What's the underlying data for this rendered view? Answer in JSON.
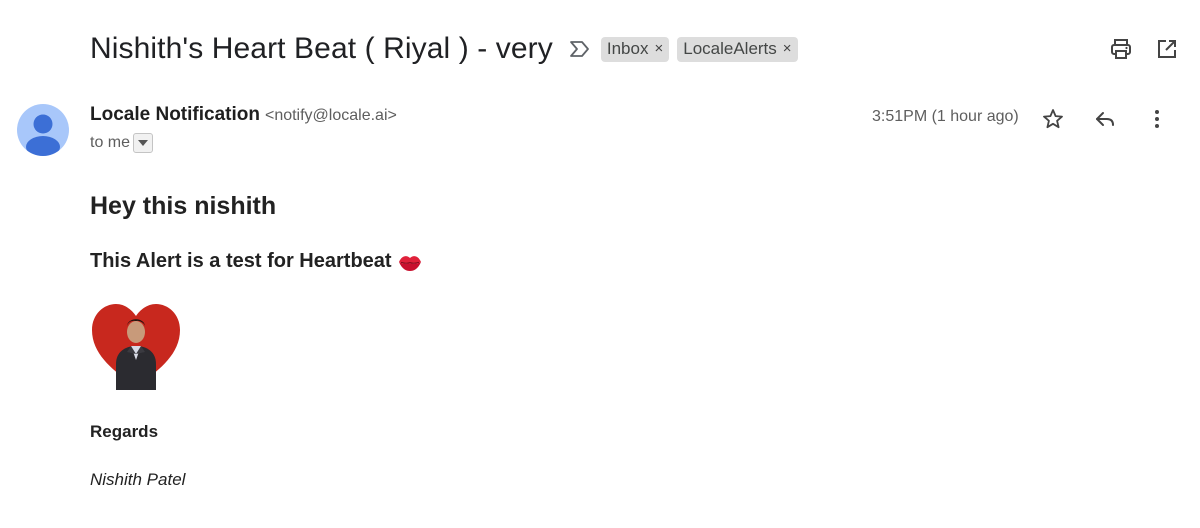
{
  "email": {
    "subject": "Nishith's Heart Beat ( Riyal ) - very",
    "labels": [
      {
        "name": "Inbox",
        "remove": "×"
      },
      {
        "name": "LocaleAlerts",
        "remove": "×"
      }
    ],
    "header_icons": [
      "print-icon",
      "open-in-new-window-icon"
    ],
    "sender": {
      "name": "Locale Notification",
      "email": "<notify@locale.ai>",
      "avatar_icon": "person-avatar-icon",
      "avatar_color": "#a8c7fa"
    },
    "recipient_text": "to me",
    "timestamp": "3:51PM (1 hour ago)",
    "message_actions": [
      "star-icon",
      "reply-icon",
      "more-vert-icon"
    ],
    "body": {
      "greeting": "Hey this nishith",
      "alert_text": "This Alert is a test for Heartbeat",
      "alert_emoji": "lips-kiss-icon",
      "image": "heart-photo-image",
      "regards": "Regards",
      "signature": "Nishith Patel"
    },
    "colors": {
      "heart": "#c8281e",
      "chip_bg": "#dddddd"
    }
  }
}
